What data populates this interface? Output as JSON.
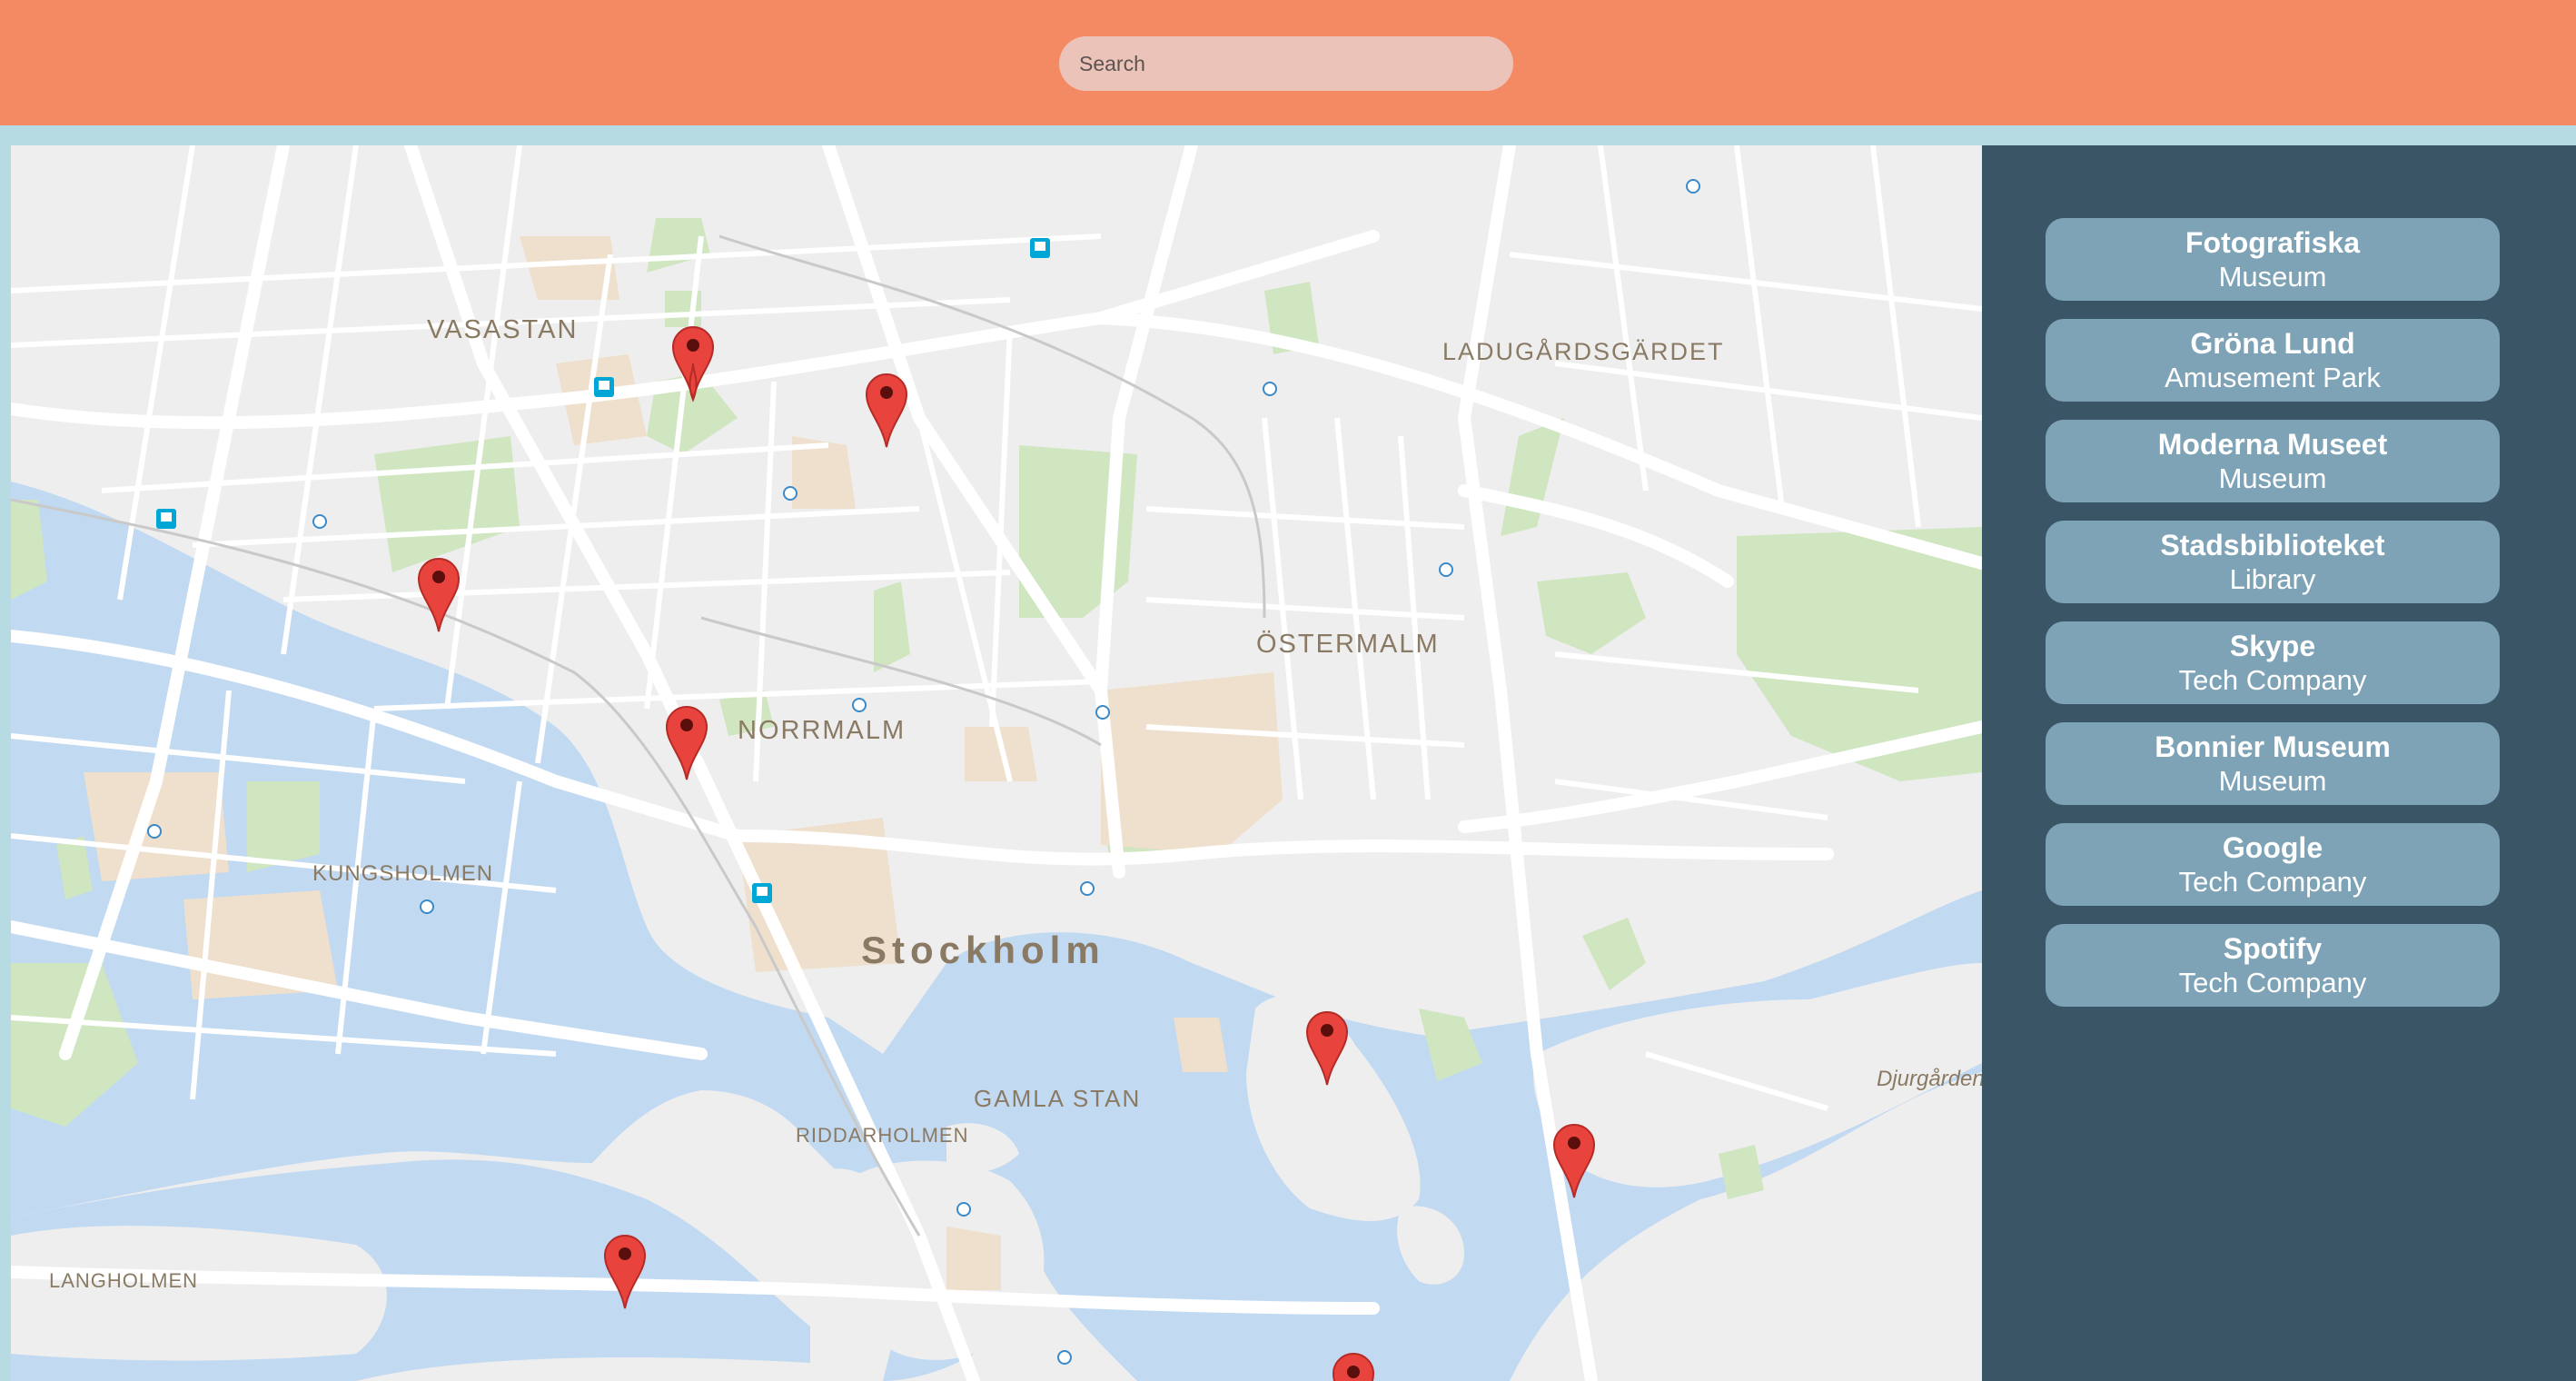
{
  "search": {
    "placeholder": "Search"
  },
  "map": {
    "labels": {
      "vasastan": "VASASTAN",
      "ladugardsgardet": "LADUGÅRDSGÄRDET",
      "ostermalm": "ÖSTERMALM",
      "norrmalm": "NORRMALM",
      "kungsholmen": "KUNGSHOLMEN",
      "stockholm": "Stockholm",
      "gamla_stan": "GAMLA STAN",
      "riddarholmen": "RIDDARHOLMEN",
      "langholmen": "LANGHOLMEN",
      "djurgarden": "Djurgården"
    }
  },
  "places": [
    {
      "name": "Fotografiska",
      "type": "Museum"
    },
    {
      "name": "Gröna Lund",
      "type": "Amusement Park"
    },
    {
      "name": "Moderna Museet",
      "type": "Museum"
    },
    {
      "name": "Stadsbiblioteket",
      "type": "Library"
    },
    {
      "name": "Skype",
      "type": "Tech Company"
    },
    {
      "name": "Bonnier Museum",
      "type": "Museum"
    },
    {
      "name": "Google",
      "type": "Tech Company"
    },
    {
      "name": "Spotify",
      "type": "Tech Company"
    }
  ],
  "colors": {
    "header": "#f38a64",
    "sidebar": "#3a5566",
    "place_button": "#7ea3b6",
    "water": "#c2d9f2",
    "park": "#cfe6c0",
    "marker": "#e8433d"
  }
}
